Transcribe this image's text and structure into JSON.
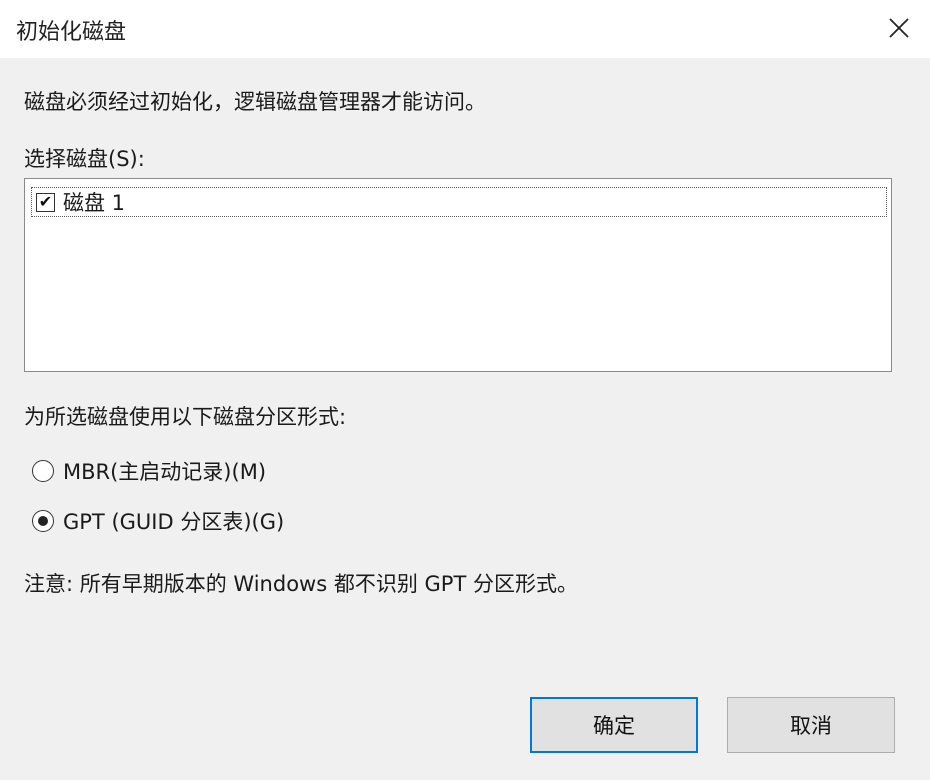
{
  "window": {
    "title": "初始化磁盘",
    "close_icon": "close-icon"
  },
  "description": "磁盘必须经过初始化，逻辑磁盘管理器才能访问。",
  "disk_select": {
    "label": "选择磁盘(S):",
    "items": [
      {
        "label": "磁盘 1",
        "checked": true
      }
    ]
  },
  "partition_style": {
    "label": "为所选磁盘使用以下磁盘分区形式:",
    "options": [
      {
        "label": "MBR(主启动记录)(M)",
        "selected": false
      },
      {
        "label": "GPT (GUID 分区表)(G)",
        "selected": true
      }
    ]
  },
  "note": "注意: 所有早期版本的 Windows 都不识别 GPT 分区形式。",
  "buttons": {
    "ok_label": "确定",
    "cancel_label": "取消"
  },
  "colors": {
    "default_button_border": "#0078d7",
    "dialog_background": "#f0f0f0"
  }
}
